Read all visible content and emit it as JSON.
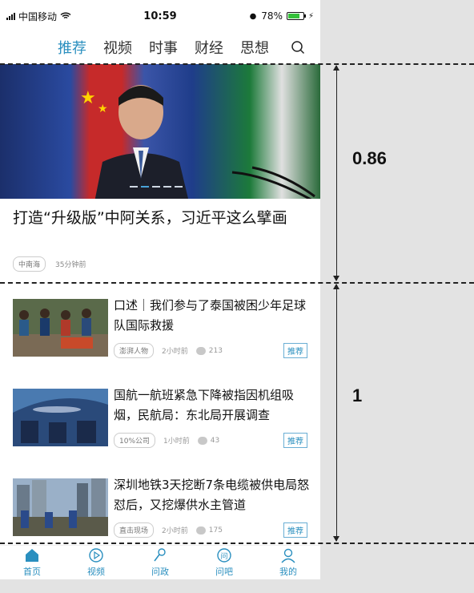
{
  "status_bar": {
    "carrier": "中国移动",
    "time": "10:59",
    "battery": "78%",
    "battery_level": 0.78
  },
  "top_tabs": [
    "推荐",
    "视频",
    "时事",
    "财经",
    "思想"
  ],
  "active_tab": 0,
  "hero": {
    "title": "打造“升级版”中阿关系，习近平这么擘画",
    "tag": "中南海",
    "time": "35分钟前"
  },
  "news": [
    {
      "title": "口述｜我们参与了泰国被困少年足球队国际救援",
      "tag": "澎湃人物",
      "time": "2小时前",
      "comments": "213",
      "label": "推荐"
    },
    {
      "title": "国航一航班紧急下降被指因机组吸烟，民航局：东北局开展调查",
      "tag": "10%公司",
      "time": "1小时前",
      "comments": "43",
      "label": "推荐"
    },
    {
      "title": "深圳地铁3天挖断7条电缆被供电局怒怼后，又挖爆供水主管道",
      "tag": "直击现场",
      "time": "2小时前",
      "comments": "175",
      "label": "推荐"
    }
  ],
  "bottom_nav": [
    "首页",
    "视频",
    "问政",
    "问吧",
    "我的"
  ],
  "annotations": {
    "hero_ratio": "0.86",
    "list_ratio": "1"
  },
  "colors": {
    "accent": "#2a8fbf",
    "background": "#e3e3e3"
  }
}
